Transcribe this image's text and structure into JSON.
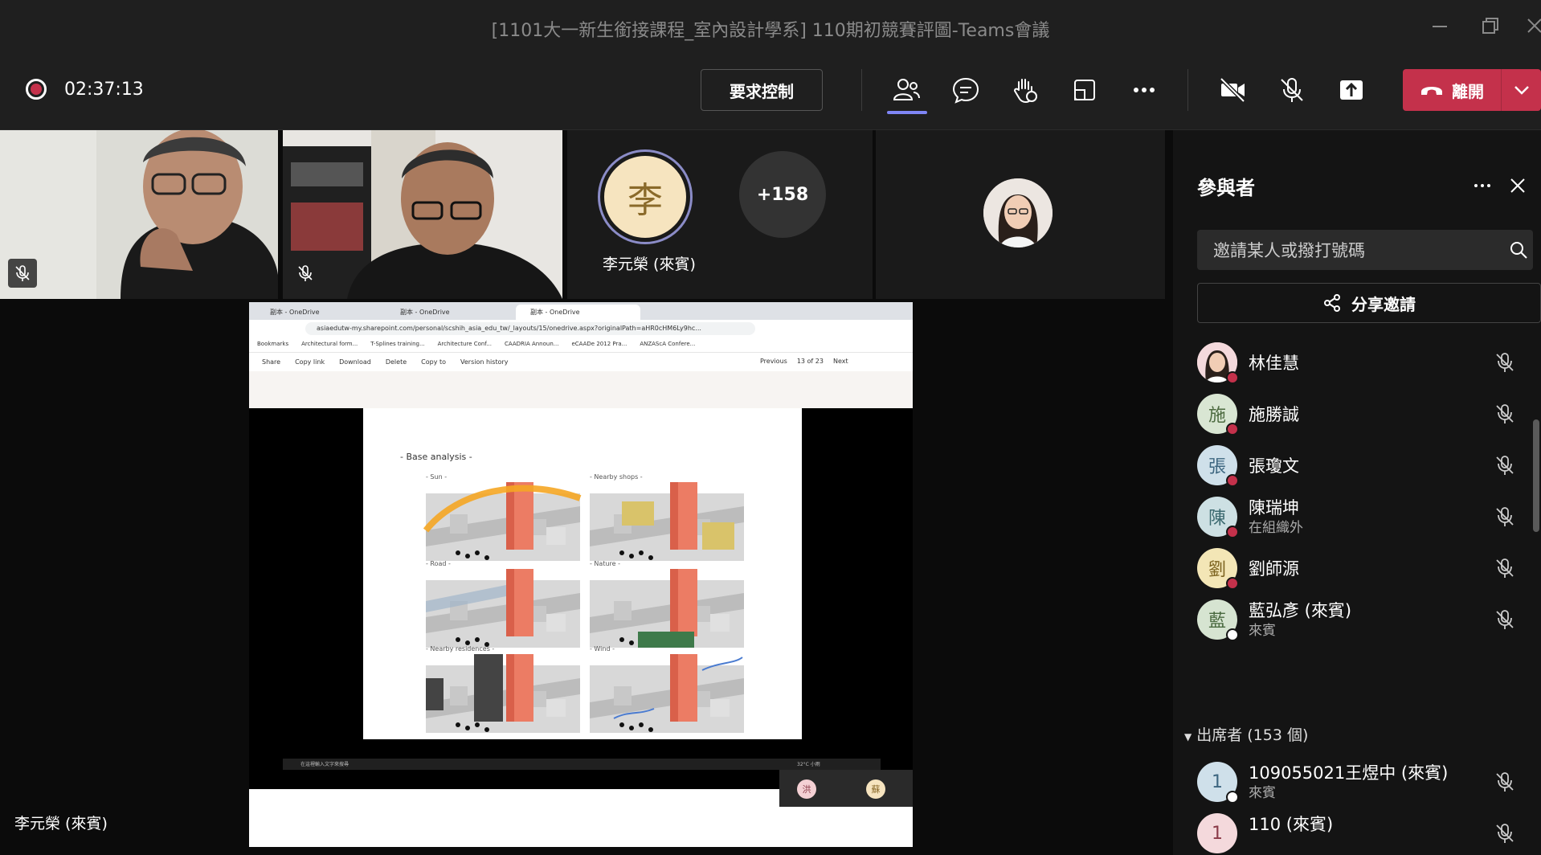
{
  "window": {
    "title": "[1101大一新生銜接課程_室內設計學系] 110期初競賽評圖-Teams會議"
  },
  "toolbar": {
    "timer": "02:37:13",
    "request_control_label": "要求控制",
    "leave_label": "離開",
    "icons": [
      "people-icon",
      "chat-icon",
      "raise-hand-icon",
      "rooms-icon",
      "more-icon",
      "camera-off-icon",
      "mic-off-icon",
      "share-tray-icon",
      "phone-icon"
    ]
  },
  "stage": {
    "avatar_initial": "李",
    "avatar_name": "李元榮 (來賓)",
    "overflow_count": "+158",
    "presenter_label": "李元榮 (來賓)"
  },
  "shared_screen": {
    "tabs": [
      "副本 - OneDrive",
      "副本 - OneDrive",
      "副本 - OneDrive"
    ],
    "url": "asiaedutw-my.sharepoint.com/personal/scshih_asia_edu_tw/_layouts/15/onedrive.aspx?originalPath=aHR0cHM6Ly9hc...",
    "bookmarks": [
      "Bookmarks",
      "Architectural form...",
      "T-Splines training...",
      "Architecture Conf...",
      "CAADRIA Announ...",
      "eCAADe 2012 Pra...",
      "ANZAScA Confere..."
    ],
    "commands": [
      "Share",
      "Copy link",
      "Download",
      "Delete",
      "Copy to",
      "Version history"
    ],
    "pager": {
      "previous": "Previous",
      "position": "13 of 23",
      "next": "Next"
    },
    "slide_title": "- Base analysis -",
    "panels": [
      "- Sun -",
      "- Nearby shops -",
      "- Road -",
      "- Nature -",
      "- Nearby residences -",
      "- Wind -"
    ],
    "taskbar_search": "在這裡輸入文字來搜尋",
    "taskbar_weather": "32°C 小雨",
    "mini_avatars": [
      "洪",
      "蘇"
    ]
  },
  "panel": {
    "title": "參與者",
    "invite_placeholder": "邀請某人或撥打號碼",
    "share_invite_label": "分享邀請",
    "people": [
      {
        "initial": "",
        "name": "林佳慧",
        "sub": "",
        "color": "#f4d9dc"
      },
      {
        "initial": "施",
        "name": "施勝誠",
        "sub": "",
        "color": "#d9e6d3"
      },
      {
        "initial": "張",
        "name": "張瓊文",
        "sub": "",
        "color": "#cfe0ea"
      },
      {
        "initial": "陳",
        "name": "陳瑞坤",
        "sub": "在組織外",
        "color": "#cde0e3"
      },
      {
        "initial": "劉",
        "name": "劉師源",
        "sub": "",
        "color": "#f3e6b6"
      },
      {
        "initial": "藍",
        "name": "藍弘彥 (來賓)",
        "sub": "來賓",
        "color": "#d6e4d1"
      }
    ],
    "section_label": "出席者 (153 個)",
    "attendees": [
      {
        "initial": "1",
        "name": "109055021王煜中 (來賓)",
        "sub": "來賓",
        "color": "#cfe0ea"
      },
      {
        "initial": "1",
        "name": "110 (來賓)",
        "sub": "",
        "color": "#f4d9dc"
      }
    ]
  }
}
